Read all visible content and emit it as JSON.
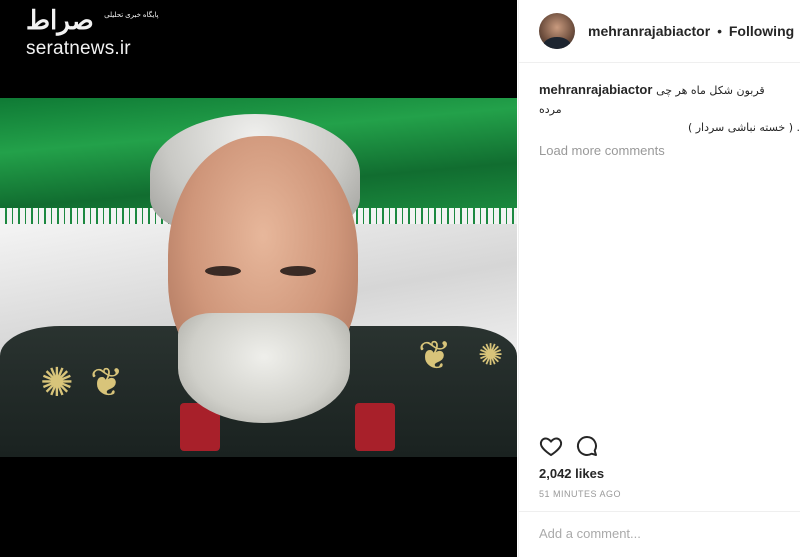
{
  "watermark": {
    "logo_text": "صراط",
    "tagline": "پایگاه خبری تحلیلی",
    "site": "seratnews.ir"
  },
  "post": {
    "username": "mehranrajabiactor",
    "separator": "•",
    "follow_status": "Following",
    "caption_user": "mehranrajabiactor",
    "caption_line1": "قربون شکل ماه هر چی مرده",
    "caption_line2": ". ( خسته نباشی سردار )",
    "load_more": "Load more comments",
    "likes": "2,042 likes",
    "time": "51 MINUTES AGO",
    "comment_placeholder": "Add a comment..."
  },
  "icons": {
    "like": "heart-icon",
    "comment": "comment-bubble-icon"
  }
}
